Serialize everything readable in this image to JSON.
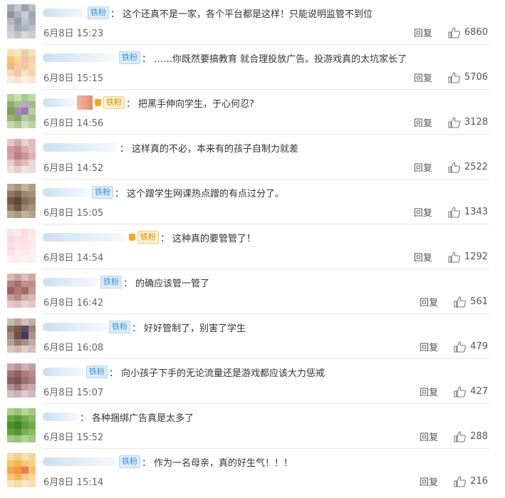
{
  "labels": {
    "reply": "回复",
    "colon": "："
  },
  "comments": [
    {
      "badge": "铁粉",
      "badge_style": "blue",
      "text": "这个还真不是一家，各个平台都是这样！只能说明监管不到位",
      "time": "6月8日 15:23",
      "likes": "6860"
    },
    {
      "badge": "铁粉",
      "badge_style": "blue",
      "text": "……你既然要搞教育 就合理投放广告。投游戏真的太坑家长了",
      "time": "6月8日 15:15",
      "likes": "5706"
    },
    {
      "badge": "铁粉",
      "badge_style": "gold",
      "text": "把黑手伸向学生，于心何忍?",
      "time": "6月8日 14:56",
      "likes": "3128"
    },
    {
      "badge": "",
      "badge_style": "none",
      "text": "这样真的不必，本来有的孩子自制力就差",
      "time": "6月8日 14:52",
      "likes": "2522"
    },
    {
      "badge": "铁粉",
      "badge_style": "blue",
      "text": "这个蹭学生网课热点蹭的有点过分了。",
      "time": "6月8日 15:05",
      "likes": "1343"
    },
    {
      "badge": "铁粉",
      "badge_style": "gold",
      "text": "这种真的要管管了！",
      "time": "6月8日 14:54",
      "likes": "1292"
    },
    {
      "badge": "铁粉",
      "badge_style": "blue",
      "text": "的确应该管一管了",
      "time": "6月8日 16:42",
      "likes": "561"
    },
    {
      "badge": "铁粉",
      "badge_style": "blue",
      "text": "好好管制了，别害了学生",
      "time": "6月8日 16:08",
      "likes": "479"
    },
    {
      "badge": "铁粉",
      "badge_style": "blue",
      "text": "向小孩子下手的无论流量还是游戏都应该大力惩戒",
      "time": "6月8日 15:07",
      "likes": "427"
    },
    {
      "badge": "",
      "badge_style": "none",
      "text": "各种捆绑广告真是太多了",
      "time": "6月8日 15:52",
      "likes": "288"
    },
    {
      "badge": "铁粉",
      "badge_style": "blue",
      "text": "作为一名母亲，真的好生气！！！",
      "time": "6月8日 15:14",
      "likes": "216"
    }
  ],
  "colors": {
    "background": "#ffffff",
    "text": "#333333",
    "meta": "#666666",
    "badge_blue": "#3d8fd8",
    "badge_gold": "#d98a05",
    "divider": "#e8e8e8"
  },
  "icons": {
    "like": "thumbs-up-icon",
    "crown": "crown-icon"
  }
}
